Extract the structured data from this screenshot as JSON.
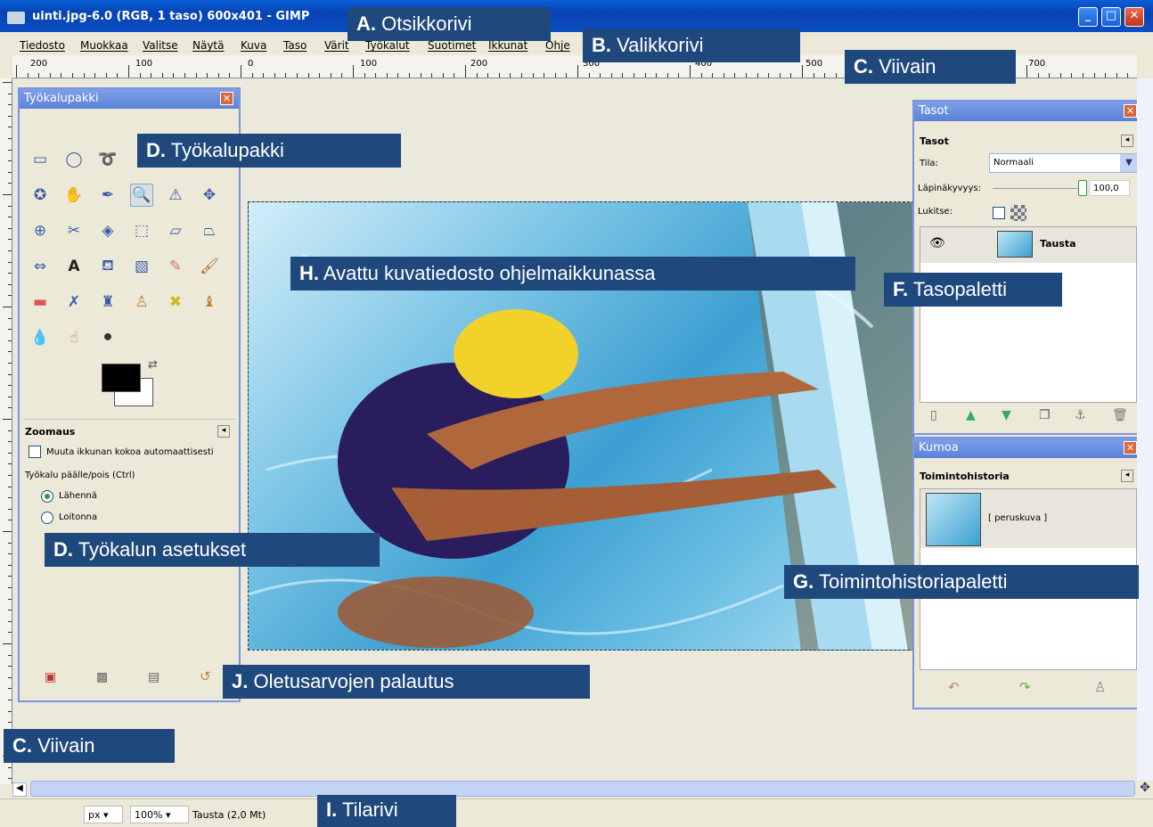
{
  "window": {
    "title": "uinti.jpg-6.0 (RGB, 1 taso) 600x401 - GIMP"
  },
  "menu": [
    "Tiedosto",
    "Muokkaa",
    "Valitse",
    "Näytä",
    "Kuva",
    "Taso",
    "Värit",
    "Työkalut",
    "Suotimet",
    "Ikkunat",
    "Ohje"
  ],
  "ruler": {
    "h_numbers": [
      "200",
      "100",
      "0",
      "100",
      "200",
      "300",
      "400",
      "500",
      "700"
    ],
    "v_numbers": [
      "1",
      "0",
      "0",
      "0",
      "1",
      "0",
      "0",
      "2",
      "0",
      "0",
      "3",
      "0",
      "0",
      "4",
      "0",
      "0",
      "5"
    ]
  },
  "toolbox": {
    "title": "Työkalupakki",
    "tools": [
      "rect-select",
      "ellipse-select",
      "lasso",
      "fuzzy-select",
      "color-select",
      "scissors",
      "paths",
      "color-picker",
      "zoom",
      "measure",
      "move",
      "align",
      "crop",
      "rotate",
      "scale",
      "shear",
      "perspective",
      "flip",
      "text",
      "bucket-fill",
      "blend",
      "pencil",
      "paintbrush",
      "eraser",
      "airbrush",
      "ink",
      "clone",
      "heal",
      "perspective-clone",
      "blur",
      "smudge",
      "dodge-burn"
    ],
    "options": {
      "heading": "Zoomaus",
      "resize_check": "Muuta ikkunan kokoa automaattisesti",
      "toggle_label": "Työkalu päälle/pois (Ctrl)",
      "radio_in": "Lähennä",
      "radio_out": "Loitonna"
    }
  },
  "layers": {
    "title": "Tasot",
    "section": "Tasot",
    "mode_label": "Tila:",
    "mode_value": "Normaali",
    "opacity_label": "Läpinäkyvyys:",
    "opacity_value": "100,0",
    "lock_label": "Lukitse:",
    "layer_name": "Tausta"
  },
  "history": {
    "title": "Kumoa",
    "section": "Toimintohistoria",
    "item": "[ peruskuva ]"
  },
  "status": {
    "unit": "px",
    "zoom": "100%",
    "info": "Tausta (2,0 Mt)"
  },
  "labels": {
    "a_key": "A.",
    "a_text": "Otsikkorivi",
    "b_key": "B.",
    "b_text": "Valikkorivi",
    "c_key": "C.",
    "c_text": "Viivain",
    "c2_key": "C.",
    "c2_text": "Viivain",
    "d_key": "D.",
    "d_text": "Työkalupakki",
    "d2_key": "D.",
    "d2_text": "Työkalun asetukset",
    "f_key": "F.",
    "f_text": "Tasopaletti",
    "g_key": "G.",
    "g_text": "Toimintohistoriapaletti",
    "h_key": "H.",
    "h_text": "Avattu kuvatiedosto ohjelmaikkunassa",
    "i_key": "I.",
    "i_text": "Tilarivi",
    "j_key": "J.",
    "j_text": "Oletusarvojen palautus"
  },
  "colors": {
    "label_bg": "#1f497d",
    "titlebar": "#0a5fd8",
    "panel_border": "#7a96df"
  }
}
